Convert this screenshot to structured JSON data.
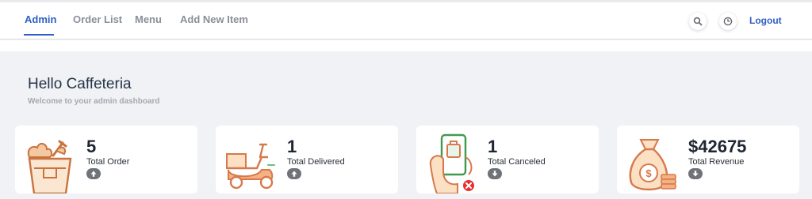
{
  "nav": {
    "tabs": [
      {
        "label": "Admin",
        "active": true
      },
      {
        "label": "Order List",
        "active": false
      },
      {
        "label": "Menu",
        "active": false
      },
      {
        "label": "Add New Item",
        "active": false
      }
    ],
    "logout_label": "Logout",
    "accent_color": "#2f5fc4"
  },
  "header": {
    "greeting": "Hello Caffeteria",
    "subtitle": "Welcome to your admin dashboard"
  },
  "stats": [
    {
      "value": "5",
      "label": "Total Order",
      "icon": "food-basket-icon",
      "trend": "up"
    },
    {
      "value": "1",
      "label": "Total Delivered",
      "icon": "delivery-scooter-icon",
      "trend": "up"
    },
    {
      "value": "1",
      "label": "Total Canceled",
      "icon": "canceled-order-phone-icon",
      "trend": "down"
    },
    {
      "value": "$42675",
      "label": "Total Revenue",
      "icon": "money-bag-icon",
      "trend": "down"
    }
  ]
}
